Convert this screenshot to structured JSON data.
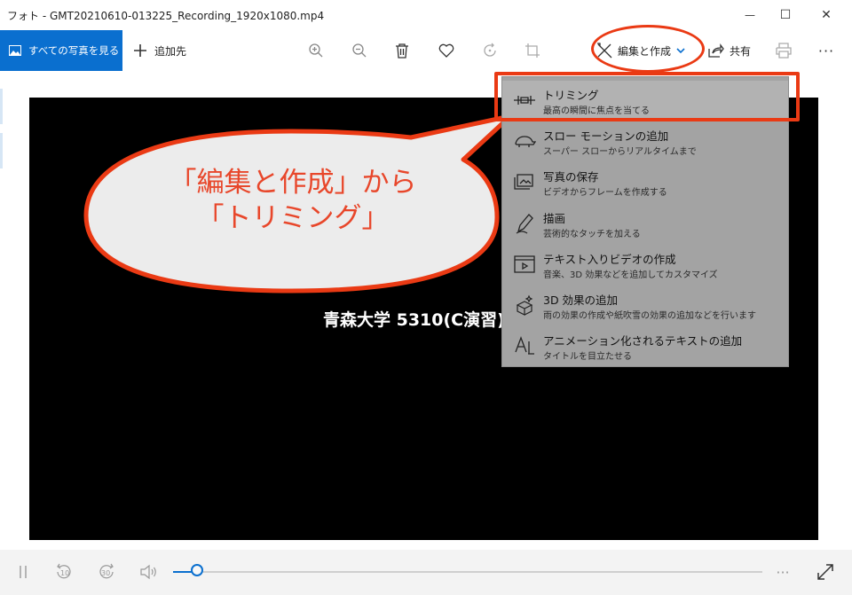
{
  "window": {
    "title": "フォト - GMT20210610-013225_Recording_1920x1080.mp4",
    "minimize_glyph": "—",
    "maximize_glyph": "☐",
    "close_glyph": "✕"
  },
  "toolbar": {
    "all_photos_label": "すべての写真を見る",
    "add_to_label": "追加先",
    "edit_create_label": "編集と作成",
    "share_label": "共有",
    "more_glyph": "···"
  },
  "icons": {
    "all_photos": "photos-icon",
    "add": "plus-icon",
    "zoom_in": "zoom-in-icon",
    "zoom_out": "zoom-out-icon",
    "delete": "trash-icon",
    "favorite": "heart-icon",
    "rotate": "rotate-icon",
    "crop": "crop-icon",
    "edit": "edit-create-icon",
    "share": "share-icon",
    "print": "print-icon"
  },
  "video": {
    "caption": "青森大学 5310(C演習)"
  },
  "player": {
    "progress_fraction": 0.04,
    "rewind_label": "10",
    "forward_label": "30",
    "more_glyph": "···"
  },
  "menu": {
    "items": [
      {
        "title": "トリミング",
        "subtitle": "最高の瞬間に焦点を当てる",
        "icon": "trim-icon"
      },
      {
        "title": "スロー モーションの追加",
        "subtitle": "スーパー スローからリアルタイムまで",
        "icon": "turtle-icon"
      },
      {
        "title": "写真の保存",
        "subtitle": "ビデオからフレームを作成する",
        "icon": "save-photo-icon"
      },
      {
        "title": "描画",
        "subtitle": "芸術的なタッチを加える",
        "icon": "pen-icon"
      },
      {
        "title": "テキスト入りビデオの作成",
        "subtitle": "音楽、3D 効果などを追加してカスタマイズ",
        "icon": "video-text-icon"
      },
      {
        "title": "3D 効果の追加",
        "subtitle": "雨の効果の作成や紙吹雪の効果の追加などを行います",
        "icon": "3d-effects-icon"
      },
      {
        "title": "アニメーション化されるテキストの追加",
        "subtitle": "タイトルを目立たせる",
        "icon": "animated-text-icon"
      }
    ]
  },
  "annotation": {
    "line1": "「編集と作成」から",
    "line2": "「トリミング」",
    "color": "#ea3a14",
    "text_color": "#e8472b"
  },
  "colors": {
    "accent": "#0a6fcf",
    "menu_bg": "#a3a3a3",
    "video_bg": "#000000"
  }
}
